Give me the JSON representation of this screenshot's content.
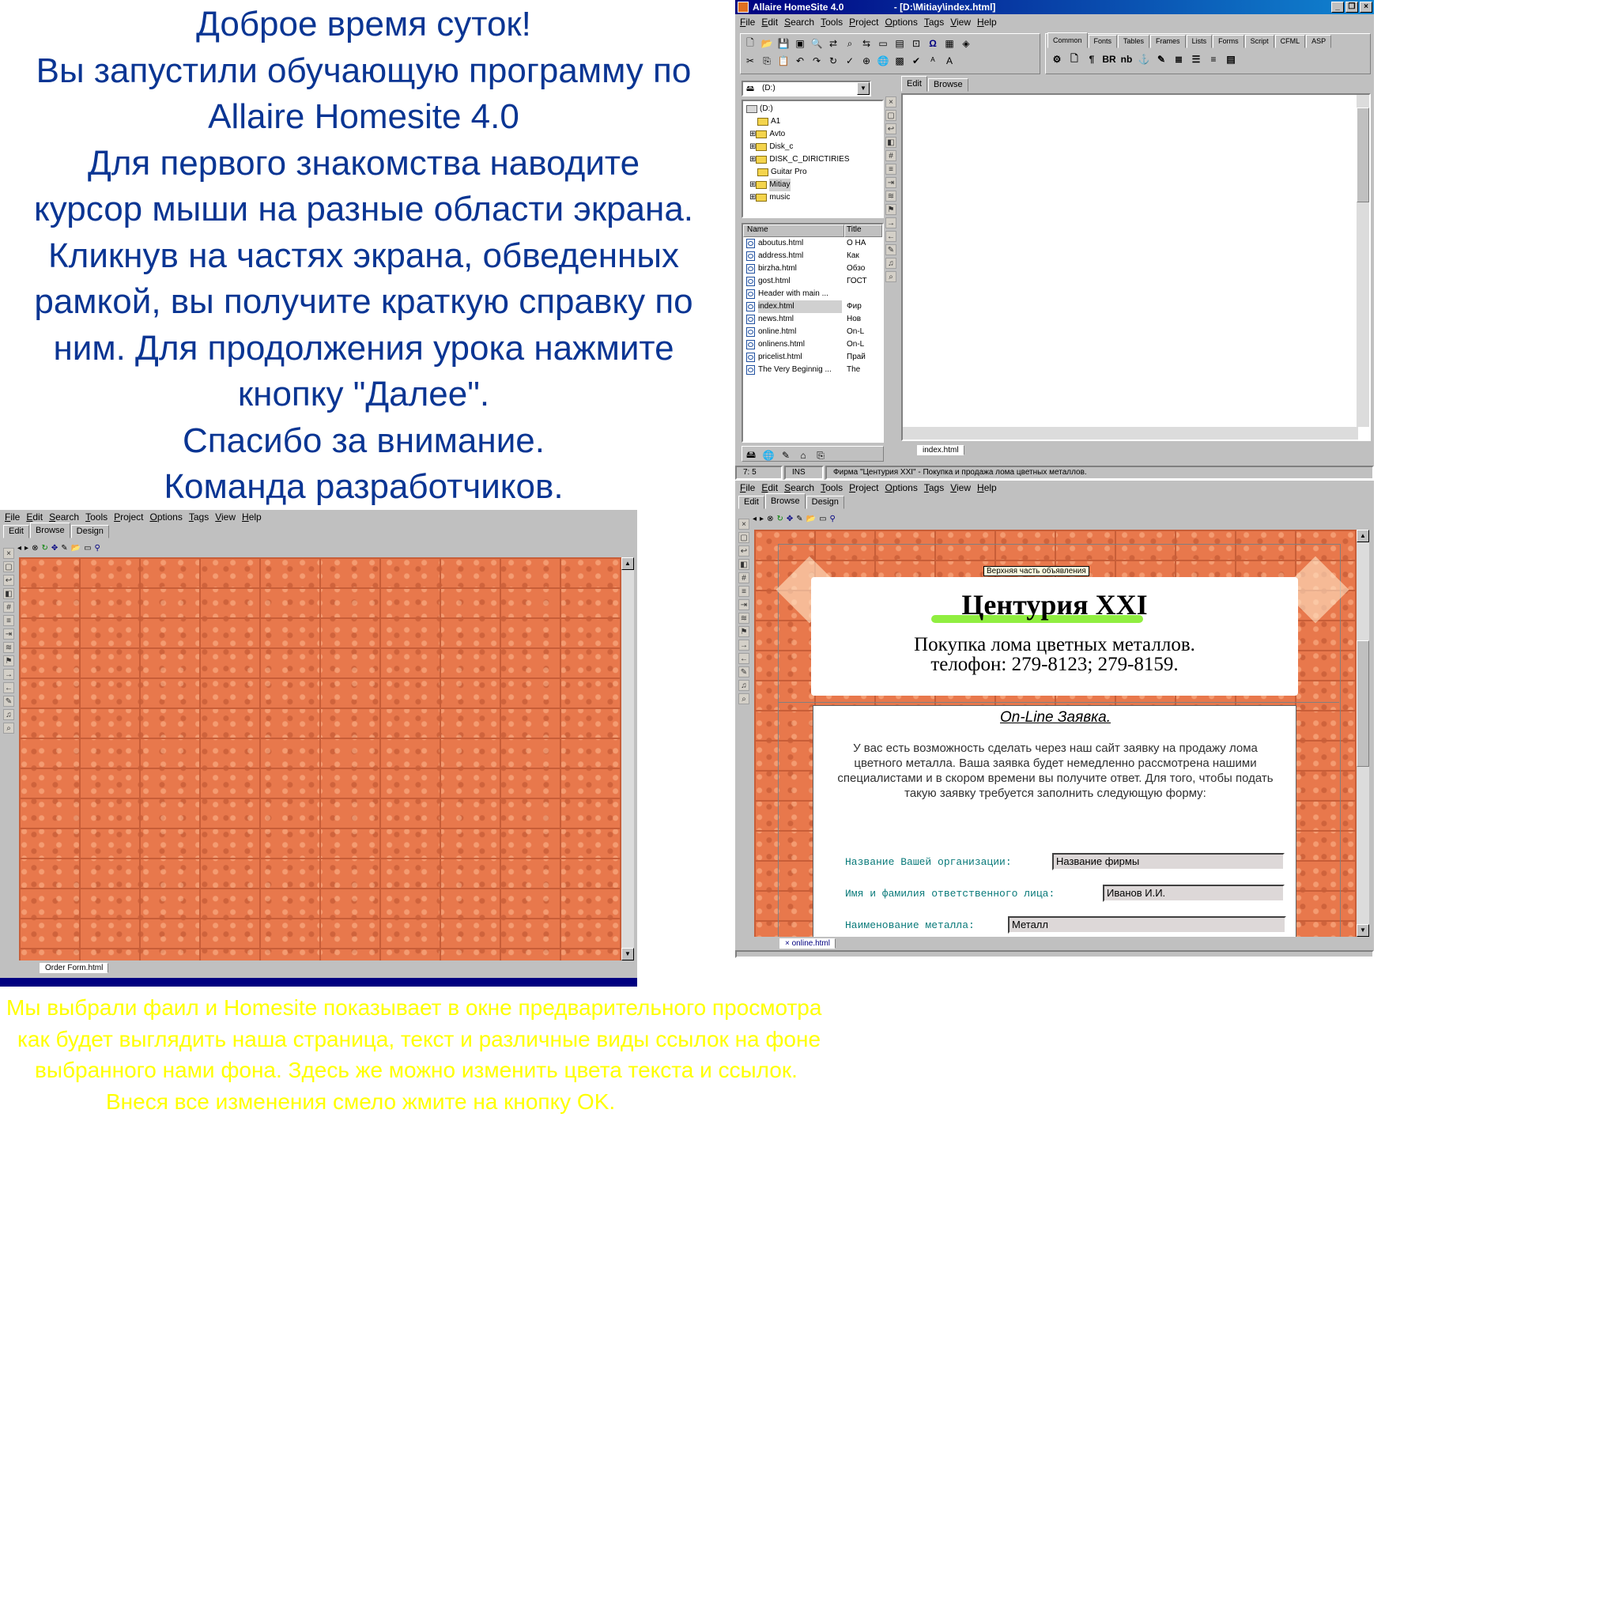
{
  "intro": {
    "lines": [
      "Доброе время суток!",
      "Вы запустили обучающую программу по",
      "Allaire Homesite 4.0",
      "Для первого знакомства наводите",
      "курсор мыши на разные области экрана.",
      "Кликнув на частях экрана, обведенных",
      "рамкой, вы получите краткую справку по",
      "ним. Для продолжения урока нажмите",
      "кнопку \"Далее\".",
      "Спасибо за внимание.",
      "Команда разработчиков."
    ]
  },
  "bottom_note": {
    "lines": [
      "Мы выбрали фаил и Homesite показывает  в окне предварительного просмотра",
      "как будет выглядить наша страница, текст и различные виды ссылок на фоне",
      "выбранного нами фона. Здесь же можно  изменить цвета  текста и ссылок.",
      "Внеся все изменения смело жмите на кнопку OK."
    ]
  },
  "menu": [
    "File",
    "Edit",
    "Search",
    "Tools",
    "Project",
    "Options",
    "Tags",
    "View",
    "Help"
  ],
  "editor_tabs": [
    "Edit",
    "Browse",
    "Design"
  ],
  "main_window": {
    "title": "Allaire HomeSite 4.0",
    "title_path": "- [D:\\Mitiay\\index.html]",
    "drive": "(D:)",
    "tag_tabs": [
      "Common",
      "Fonts",
      "Tables",
      "Frames",
      "Lists",
      "Forms",
      "Script",
      "CFML",
      "ASP"
    ],
    "folders": [
      "(D:)",
      "A1",
      "Avto",
      "Disk_c",
      "DISK_C_DIRICTIRIES",
      "Guitar Pro",
      "Mitiay",
      "music"
    ],
    "file_columns": [
      "Name",
      "Title"
    ],
    "files": [
      {
        "name": "aboutus.html",
        "title": "О НА"
      },
      {
        "name": "address.html",
        "title": "Как"
      },
      {
        "name": "birzha.html",
        "title": "Обзо"
      },
      {
        "name": "gost.html",
        "title": "ГОСТ"
      },
      {
        "name": "Header with main ...",
        "title": ""
      },
      {
        "name": "index.html",
        "title": "Фир"
      },
      {
        "name": "news.html",
        "title": "Нов"
      },
      {
        "name": "online.html",
        "title": "On-L"
      },
      {
        "name": "onlinens.html",
        "title": "On-L"
      },
      {
        "name": "pricelist.html",
        "title": "Прай"
      },
      {
        "name": "The Very Beginnig ...",
        "title": "The"
      }
    ],
    "edit_tabs": [
      "Edit",
      "Browse"
    ],
    "doc_tab": "index.html",
    "status_pos": "7: 5",
    "status_mode": "INS",
    "status_text": "Фирма \"Центурия XXI\" - Покупка и продажа лома цветных металлов."
  },
  "left_window": {
    "doc_tab": "Order Form.html"
  },
  "right_window": {
    "doc_tab": "online.html",
    "tooltip": "Верхняя часть объявления",
    "company": "Центурия XXI",
    "subtitle": "Покупка лома цветных металлов.",
    "phone": "телофон: 279-8123; 279-8159.",
    "online_heading": "On-Line Заявка.",
    "paragraph": "У вас есть возможность сделать через наш сайт заявку на продажу лома цветного металла. Ваша заявка будет немедленно рассмотрена нашими специалистами и в скором времени вы получите ответ. Для того, чтобы подать такую заявку требуется заполнить следующую форму:",
    "fields": [
      {
        "label": "Название Вашей организации:",
        "value": "Название фирмы"
      },
      {
        "label": "Имя и фамилия ответственного лица:",
        "value": "Иванов И.И."
      },
      {
        "label": "Наименование металла:",
        "value": "Металл"
      }
    ]
  },
  "colors": {
    "intro_text": "#0a3593",
    "note_text": "#ffff00",
    "brick": "#e8784c",
    "titlebar": "#000080"
  }
}
